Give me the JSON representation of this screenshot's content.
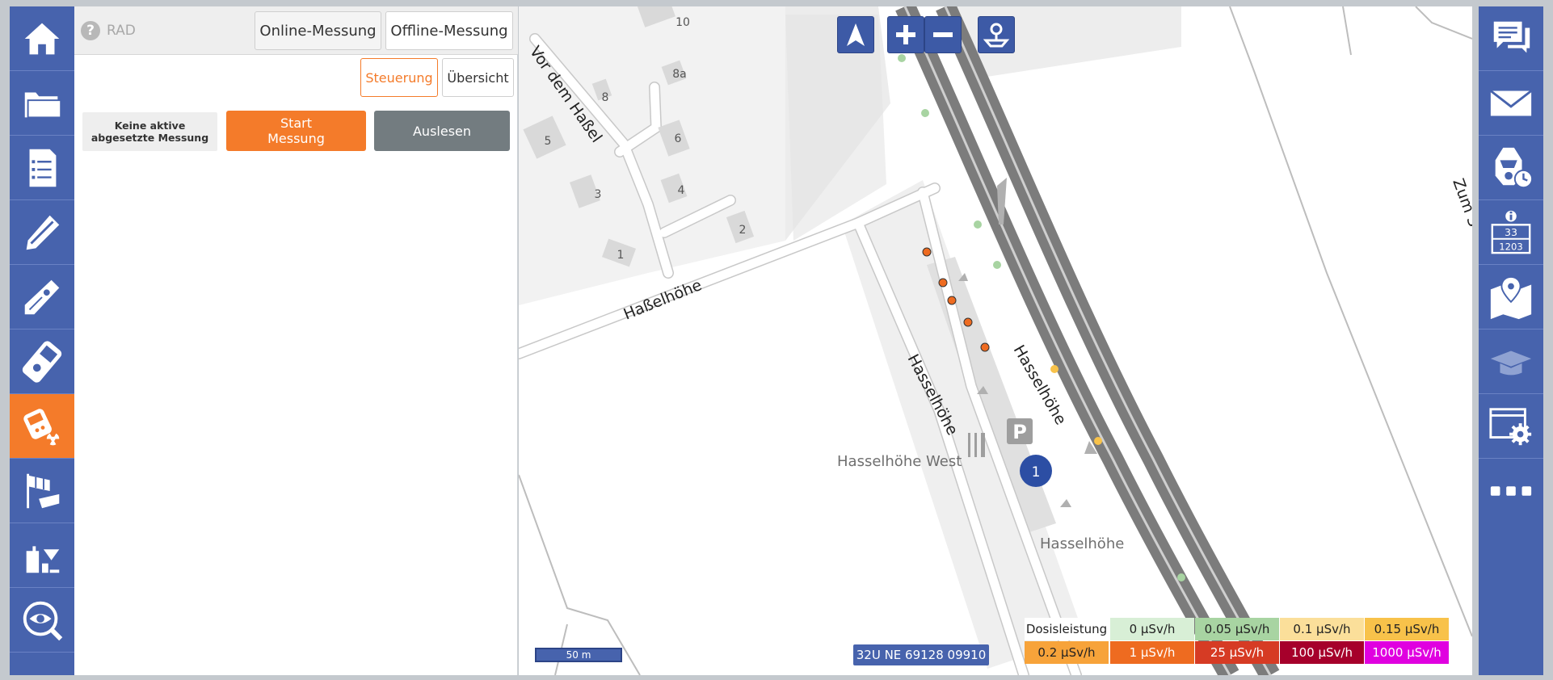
{
  "header": {
    "title": "RAD",
    "modes": [
      "Online-Messung",
      "Offline-Messung"
    ],
    "sub_tabs": [
      "Steuerung",
      "Übersicht"
    ]
  },
  "control": {
    "status": "Keine aktive abgesetzte Messung",
    "start_label": "Start\nMessung",
    "read_label": "Auslesen"
  },
  "left_nav": [
    "home-icon",
    "folder-icon",
    "checklist-icon",
    "gas-pen-icon",
    "dosimeter-pen-icon",
    "gas-detector-icon",
    "radiation-meter-icon",
    "wind-sock-icon",
    "sampling-bottles-icon",
    "observation-eye-icon"
  ],
  "right_nav": [
    "chat-icon",
    "mail-icon",
    "respirator-timer-icon",
    "hazard-number-icon",
    "map-pin-icon",
    "training-cap-icon",
    "settings-window-icon",
    "more-icon"
  ],
  "map": {
    "labels": {
      "vor_dem_hassel": "Vor dem Haßel",
      "hasselhoehe_road": "Haßelhöhe",
      "hasselhoehe_1": "Hasselhöhe",
      "hasselhoehe_2": "Hasselhöhe",
      "west": "Hasselhöhe West",
      "hasselhoehe_3": "Hasselhöhe",
      "zum": "Zum S"
    },
    "house_numbers": [
      "10",
      "8",
      "8a",
      "5",
      "6",
      "3",
      "4",
      "2",
      "1"
    ],
    "parking": "P",
    "marker_number": "1",
    "scale": "50 m",
    "coordinates": "32U NE 69128 09910"
  },
  "legend": {
    "title": "Dosisleistung",
    "items": [
      {
        "label": "0 µSv/h",
        "color": "#d8efd6"
      },
      {
        "label": "0.05 µSv/h",
        "color": "#a8d4a2"
      },
      {
        "label": "0.1 µSv/h",
        "color": "#fbdf9a"
      },
      {
        "label": "0.15 µSv/h",
        "color": "#f8c24a"
      },
      {
        "label": "0.2 µSv/h",
        "color": "#f7a33a"
      },
      {
        "label": "1 µSv/h",
        "color": "#ee6b20"
      },
      {
        "label": "25 µSv/h",
        "color": "#d63b24"
      },
      {
        "label": "100 µSv/h",
        "color": "#a6002b"
      },
      {
        "label": "1000 µSv/h",
        "color": "#e000e0"
      }
    ]
  },
  "colors": {
    "accent": "#f47b2a",
    "nav_blue": "#4763ad",
    "read_button": "#737c80"
  }
}
